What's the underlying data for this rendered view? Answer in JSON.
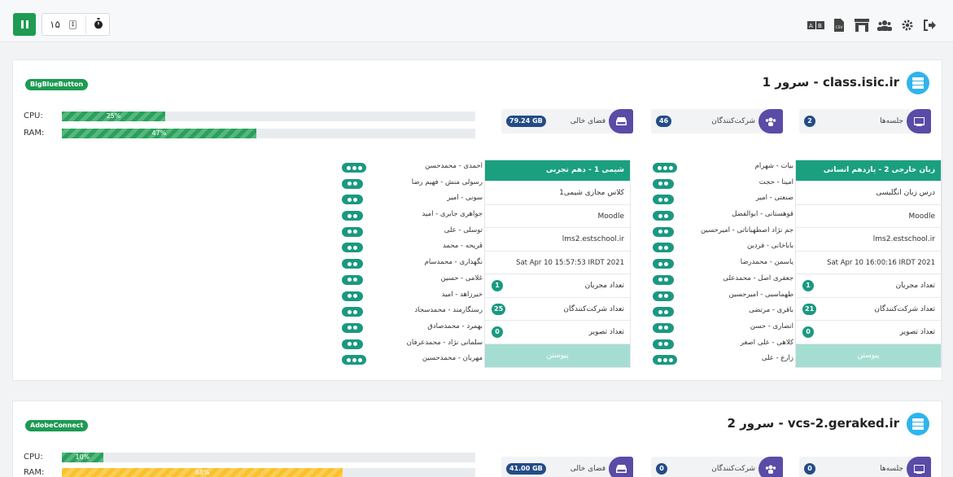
{
  "toolbar": {
    "interval": "۱۵",
    "icons": [
      "logout-icon",
      "settings-icon",
      "users-icon",
      "store-icon",
      "csv-icon",
      "language-icon"
    ]
  },
  "servers": [
    {
      "title": "class.isic.ir - سرور 1",
      "platform": "BigBlueButton",
      "cpu_label": "CPU:",
      "ram_label": "RAM:",
      "cpu_percent": 25,
      "cpu_text": "25%",
      "ram_percent": 47,
      "ram_text": "47%",
      "stats": {
        "sessions_label": "جلسه‌ها",
        "sessions": "2",
        "participants_label": "شرکت‌کنندگان",
        "participants": "46",
        "disk_label": "فضای خالی",
        "disk": "79.24 GB"
      },
      "meetings": [
        {
          "name": "زبان خارجی 2 - یازدهم انسانی",
          "description": "درس زبان انگلیسی",
          "origin": "Moodle",
          "host": "lms2.estschool.ir",
          "created": "Sat Apr 10 16:00:16 IRDT 2021",
          "moderators_label": "تعداد مجریان",
          "moderators": "1",
          "participants_label": "تعداد شرکت‌کنندگان",
          "participants": "21",
          "video_label": "تعداد تصویر",
          "video": "0",
          "join_label": "پیوستن",
          "people": [
            "بیات - شهرام",
            "امینا - حجت",
            "صنعتی - امیر",
            "قوهستانی - ابوالفضل",
            "جم نژاد اصطهباناتی - امیرحسین",
            "باباخانی - فردین",
            "یاسمن - محمدرضا",
            "جعفری اصل - محمدعلی",
            "طهماسبی - امیرحسین",
            "باقری - مرتضی",
            "انصاری - حسن",
            "کلاهی - علی اصغر",
            "زارع - علی"
          ]
        },
        {
          "name": "شیمی 1 - دهم تجربی",
          "description": "کلاس مجازی شیمی1",
          "origin": "Moodle",
          "host": "lms2.estschool.ir",
          "created": "Sat Apr 10 15:57:53 IRDT 2021",
          "moderators_label": "تعداد مجریان",
          "moderators": "1",
          "participants_label": "تعداد شرکت‌کنندگان",
          "participants": "25",
          "video_label": "تعداد تصویر",
          "video": "0",
          "join_label": "پیوستن",
          "people": [
            "احمدی - محمدحسن",
            "رسولی منش - فهیم رضا",
            "سونی - امیر",
            "جواهری جابری - امید",
            "توسلی - علی",
            "قریحه - محمد",
            "نگهداری - محمدسام",
            "غلامی - حسین",
            "خیرزاهد - امید",
            "رستگارمند - محمدسجاد",
            "بهمرد - محمدصادق",
            "سلمانی نژاد - محمدعرفان",
            "مهربان - محمدحسین"
          ]
        }
      ]
    },
    {
      "title": "vcs-2.geraked.ir - سرور 2",
      "platform": "AdobeConnect",
      "cpu_label": "CPU:",
      "ram_label": "RAM:",
      "cpu_percent": 10,
      "cpu_text": "10%",
      "ram_percent": 68,
      "ram_text": "68%",
      "stats": {
        "sessions_label": "جلسه‌ها",
        "sessions": "0",
        "participants_label": "شرکت‌کنندگان",
        "participants": "0",
        "disk_label": "فضای خالی",
        "disk": "41.00 GB"
      }
    }
  ]
}
